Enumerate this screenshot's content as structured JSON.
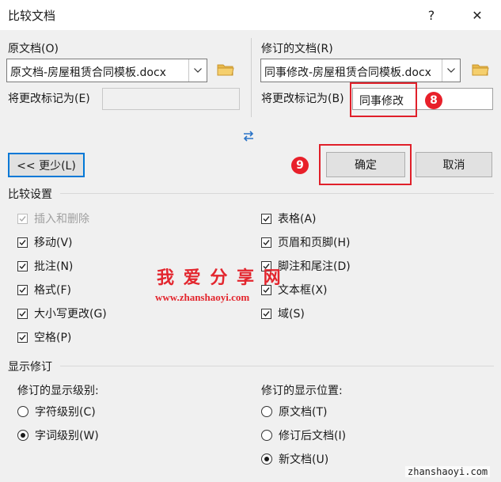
{
  "window": {
    "title": "比较文档",
    "help_glyph": "?",
    "close_glyph": "✕"
  },
  "original": {
    "label": "原文档(O)",
    "file": "原文档-房屋租赁合同模板.docx",
    "mark_label": "将更改标记为(E)",
    "mark_value": ""
  },
  "revised": {
    "label": "修订的文档(R)",
    "file": "同事修改-房屋租赁合同模板.docx",
    "mark_label": "将更改标记为(B)",
    "mark_value": "同事修改"
  },
  "buttons": {
    "less": "<< 更少(L)",
    "ok": "确定",
    "cancel": "取消"
  },
  "annotations": {
    "badge_8": "8",
    "badge_9": "9"
  },
  "compare_settings": {
    "heading": "比较设置",
    "left": [
      {
        "label": "插入和删除",
        "checked": true,
        "disabled": true
      },
      {
        "label": "移动(V)",
        "checked": true
      },
      {
        "label": "批注(N)",
        "checked": true
      },
      {
        "label": "格式(F)",
        "checked": true
      },
      {
        "label": "大小写更改(G)",
        "checked": true
      },
      {
        "label": "空格(P)",
        "checked": true
      }
    ],
    "right": [
      {
        "label": "表格(A)",
        "checked": true
      },
      {
        "label": "页眉和页脚(H)",
        "checked": true
      },
      {
        "label": "脚注和尾注(D)",
        "checked": true
      },
      {
        "label": "文本框(X)",
        "checked": true
      },
      {
        "label": "域(S)",
        "checked": true
      }
    ]
  },
  "show_changes": {
    "heading": "显示修订",
    "level_label": "修订的显示级别:",
    "level_options": [
      {
        "label": "字符级别(C)",
        "selected": false
      },
      {
        "label": "字词级别(W)",
        "selected": true
      }
    ],
    "position_label": "修订的显示位置:",
    "position_options": [
      {
        "label": "原文档(T)",
        "selected": false
      },
      {
        "label": "修订后文档(I)",
        "selected": false
      },
      {
        "label": "新文档(U)",
        "selected": true
      }
    ]
  },
  "watermark": {
    "text": "我 爱 分 享 网",
    "url": "www.zhanshaoyi.com",
    "corner": "zhanshaoyi.com"
  },
  "colors": {
    "accent_red": "#e0202a",
    "focus_blue": "#0078d7",
    "folder": "#e8b84a",
    "swap_blue": "#2b74c7"
  }
}
